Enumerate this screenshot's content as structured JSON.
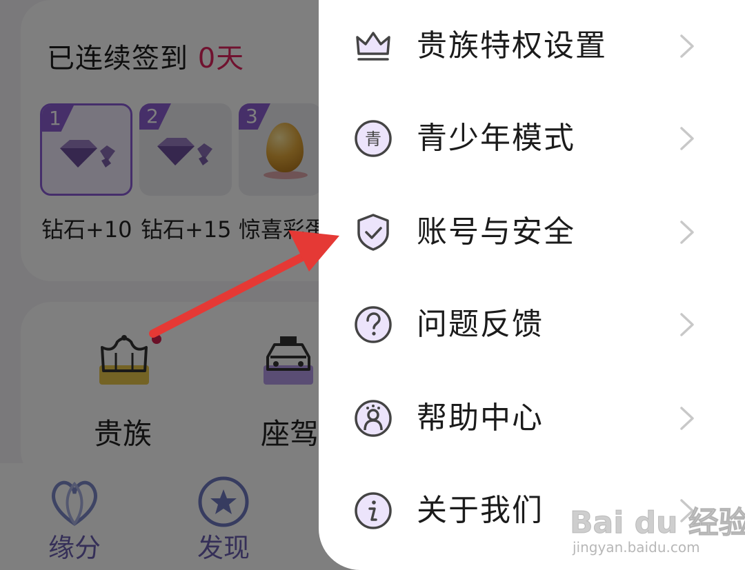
{
  "signin": {
    "title_prefix": "已连续签到 ",
    "days": "0天",
    "rewards": [
      {
        "day": "1",
        "label": "钻石+10",
        "icon": "diamond-icon"
      },
      {
        "day": "2",
        "label": "钻石+15",
        "icon": "diamond-icon"
      },
      {
        "day": "3",
        "label": "惊喜彩蛋",
        "icon": "golden-egg-icon"
      }
    ]
  },
  "features": [
    {
      "label": "贵族",
      "icon": "crown-icon"
    },
    {
      "label": "座驾",
      "icon": "car-icon"
    }
  ],
  "bottom_nav": [
    {
      "label": "缘分",
      "icon": "heart-loop-icon"
    },
    {
      "label": "发现",
      "icon": "star-circle-icon"
    }
  ],
  "menu": {
    "items": [
      {
        "label": "贵族特权设置",
        "icon": "crown-icon"
      },
      {
        "label": "青少年模式",
        "icon": "youth-mode-icon",
        "icon_text": "青"
      },
      {
        "label": "账号与安全",
        "icon": "shield-check-icon"
      },
      {
        "label": "问题反馈",
        "icon": "question-icon"
      },
      {
        "label": "帮助中心",
        "icon": "help-person-icon"
      },
      {
        "label": "关于我们",
        "icon": "info-icon"
      }
    ]
  },
  "watermark": {
    "logo": "Bai du 经验",
    "url": "jingyan.baidu.com"
  },
  "colors": {
    "accent": "#8d5fd3",
    "days_highlight": "#e0245e",
    "annotation_arrow": "#e53935"
  }
}
